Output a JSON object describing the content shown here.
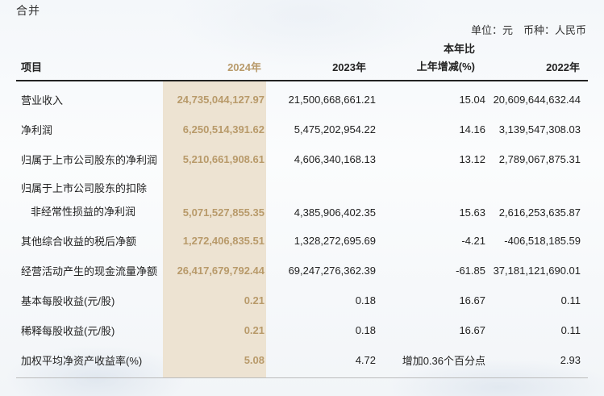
{
  "section_title": "合并",
  "unit_line": "单位：元　币种：人民币",
  "colors": {
    "highlight_column": "#ede3d2",
    "highlight_text": "#b89a6a",
    "text": "#222222"
  },
  "headers": {
    "item": "项目",
    "y2024": "2024年",
    "y2023": "2023年",
    "change_line1": "本年比",
    "change_line2": "上年增减(%)",
    "y2022": "2022年"
  },
  "rows": [
    {
      "label": "营业收入",
      "v2024": "24,735,044,127.97",
      "v2023": "21,500,668,661.21",
      "change": "15.04",
      "v2022": "20,609,644,632.44"
    },
    {
      "label": "净利润",
      "v2024": "6,250,514,391.62",
      "v2023": "5,475,202,954.22",
      "change": "14.16",
      "v2022": "3,139,547,308.03"
    },
    {
      "label": "归属于上市公司股东的净利润",
      "v2024": "5,210,661,908.61",
      "v2023": "4,606,340,168.13",
      "change": "13.12",
      "v2022": "2,789,067,875.31"
    },
    {
      "label_line1": "归属于上市公司股东的扣除",
      "label_line2": "非经常性损益的净利润",
      "v2024": "5,071,527,855.35",
      "v2023": "4,385,906,402.35",
      "change": "15.63",
      "v2022": "2,616,253,635.87"
    },
    {
      "label": "其他综合收益的税后净额",
      "v2024": "1,272,406,835.51",
      "v2023": "1,328,272,695.69",
      "change": "-4.21",
      "v2022": "-406,518,185.59"
    },
    {
      "label": "经营活动产生的现金流量净额",
      "v2024": "26,417,679,792.44",
      "v2023": "69,247,276,362.39",
      "change": "-61.85",
      "v2022": "37,181,121,690.01"
    },
    {
      "label": "基本每股收益(元/股)",
      "v2024": "0.21",
      "v2023": "0.18",
      "change": "16.67",
      "v2022": "0.11"
    },
    {
      "label": "稀释每股收益(元/股)",
      "v2024": "0.21",
      "v2023": "0.18",
      "change": "16.67",
      "v2022": "0.11"
    },
    {
      "label": "加权平均净资产收益率(%)",
      "v2024": "5.08",
      "v2023": "4.72",
      "change": "增加0.36个百分点",
      "v2022": "2.93"
    }
  ]
}
